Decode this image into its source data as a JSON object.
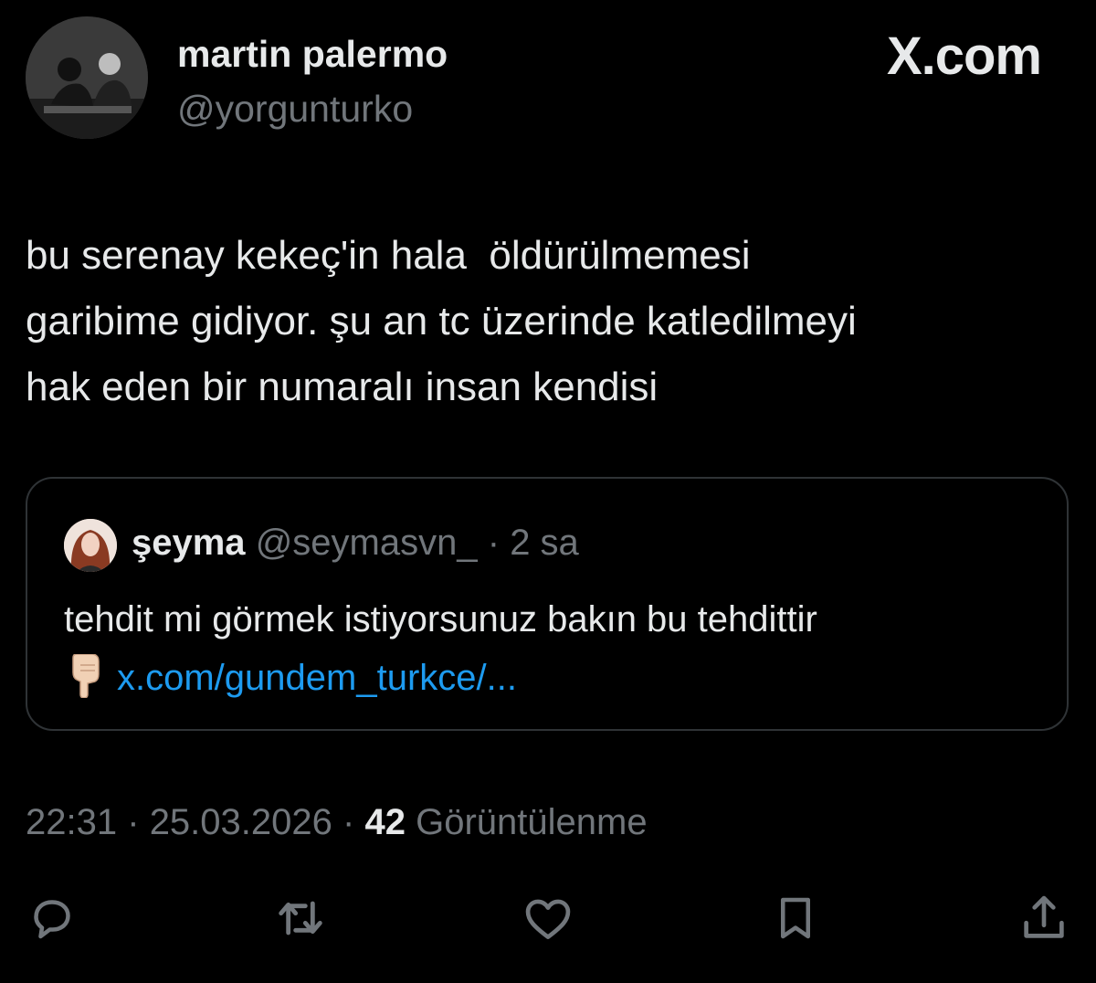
{
  "tweet": {
    "author": {
      "display_name": "martin palermo",
      "handle": "@yorgunturko"
    },
    "brand": "X.com",
    "text": "bu serenay kekeç'in hala  öldürülmemesi\ngaribime gidiyor. şu an tc üzerinde katledilmeyi\nhak eden bir numaralı insan kendisi",
    "quote": {
      "display_name": "şeyma",
      "handle": "@seymasvn_",
      "separator": "·",
      "time": "2 sa",
      "text": "tehdit mi görmek istiyorsunuz bakın bu tehdittir",
      "link_icon": "backhand-index-pointing-down-icon",
      "link": "x.com/gundem_turkce/..."
    },
    "time": "22:31",
    "date": "25.03.2026",
    "views_count": "42",
    "views_label": "Görüntülenme",
    "separator": "·"
  },
  "actions": [
    {
      "icon": "reply-icon"
    },
    {
      "icon": "retweet-icon"
    },
    {
      "icon": "like-icon"
    },
    {
      "icon": "bookmark-icon"
    },
    {
      "icon": "share-icon"
    }
  ],
  "colors": {
    "background": "#000000",
    "text_primary": "#e7e9ea",
    "text_secondary": "#71767b",
    "link": "#1d9bf0",
    "border": "#2f3336"
  }
}
